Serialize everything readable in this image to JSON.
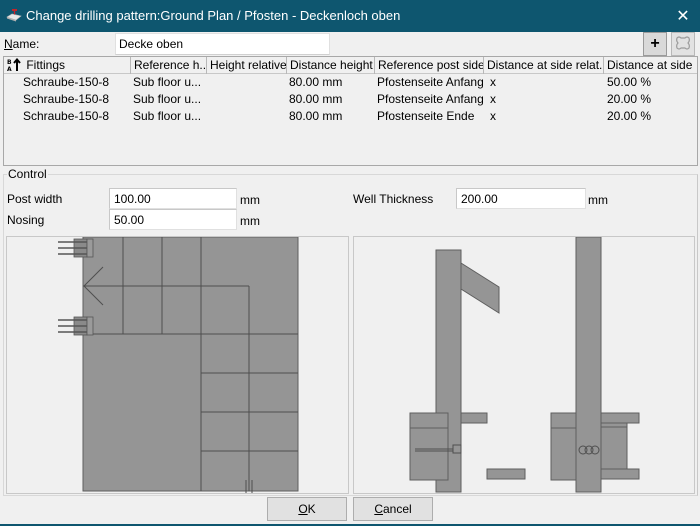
{
  "window": {
    "title": "Change drilling pattern:Ground Plan / Pfosten - Deckenloch oben",
    "app_icon": "drilling-machine-icon",
    "close_icon": "close-icon",
    "close_glyph": "✕"
  },
  "name": {
    "label_accel": "N",
    "label_rest": "ame:",
    "value": "Decke oben"
  },
  "toolbar": {
    "add_label": "+",
    "add_icon": "plus-icon",
    "delete_icon": "delete-fitting-icon"
  },
  "table": {
    "sort_icon": "sort-az-ascending-icon",
    "columns": [
      "Fittings",
      "Reference h...",
      "Height relative",
      "Distance height",
      "Reference post side",
      "Distance at side relat...",
      "Distance at side"
    ],
    "rows": [
      [
        "Schraube-150-8",
        "Sub floor u...",
        "",
        "80.00 mm",
        "Pfostenseite Anfang",
        "x",
        "50.00 %"
      ],
      [
        "Schraube-150-8",
        "Sub floor u...",
        "",
        "80.00 mm",
        "Pfostenseite Anfang",
        "x",
        "20.00 %"
      ],
      [
        "Schraube-150-8",
        "Sub floor u...",
        "",
        "80.00 mm",
        "Pfostenseite Ende",
        "x",
        "20.00 %"
      ]
    ]
  },
  "control": {
    "legend": "Control",
    "post_width": {
      "label": "Post width",
      "value": "100.00",
      "unit": "mm"
    },
    "nosing": {
      "label": "Nosing",
      "value": "50.00",
      "unit": "mm"
    },
    "well_thickness": {
      "label": "Well Thickness",
      "value": "200.00",
      "unit": "mm"
    }
  },
  "previews": {
    "plan_view": "stair-plan-preview",
    "section_view": "stair-section-preview"
  },
  "buttons": {
    "ok_accel": "O",
    "ok_rest": "K",
    "cancel_accel": "C",
    "cancel_rest": "ancel"
  }
}
